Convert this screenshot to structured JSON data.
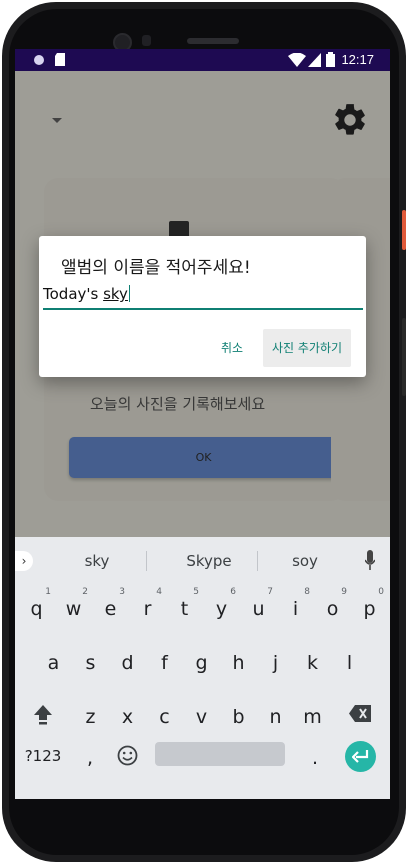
{
  "status": {
    "time": "12:17"
  },
  "app": {
    "card_text": "오늘의 사진을 기록해보세요",
    "ok_label": "OK"
  },
  "dialog": {
    "title": "앨범의 이름을 적어주세요!",
    "input_prefix": "Today's ",
    "input_underlined": "sky",
    "cancel_label": "취소",
    "add_label": "사진 추가하기"
  },
  "keyboard": {
    "suggestions": [
      "sky",
      "Skype",
      "soy"
    ],
    "row1": [
      {
        "k": "q",
        "h": "1"
      },
      {
        "k": "w",
        "h": "2"
      },
      {
        "k": "e",
        "h": "3"
      },
      {
        "k": "r",
        "h": "4"
      },
      {
        "k": "t",
        "h": "5"
      },
      {
        "k": "y",
        "h": "6"
      },
      {
        "k": "u",
        "h": "7"
      },
      {
        "k": "i",
        "h": "8"
      },
      {
        "k": "o",
        "h": "9"
      },
      {
        "k": "p",
        "h": "0"
      }
    ],
    "row2": [
      "a",
      "s",
      "d",
      "f",
      "g",
      "h",
      "j",
      "k",
      "l"
    ],
    "row3": [
      "z",
      "x",
      "c",
      "v",
      "b",
      "n",
      "m"
    ],
    "sym_label": "?123",
    "comma_label": ",",
    "period_label": "."
  },
  "colors": {
    "accent": "#0f7f73",
    "statusbar": "#1e0a52",
    "ok_button": "#5a86d8",
    "enter_key": "#26b6a7"
  }
}
